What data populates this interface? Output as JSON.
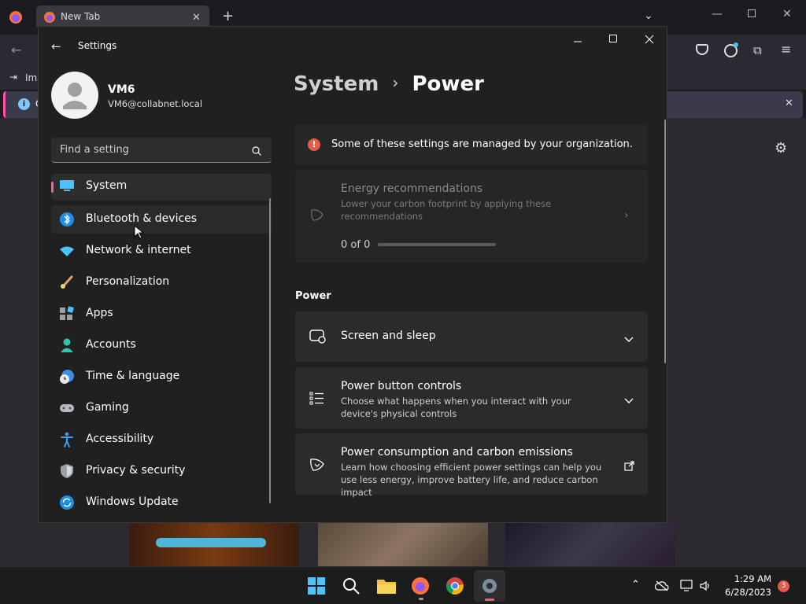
{
  "browser": {
    "tab_title": "New Tab",
    "bookmark_import_label": "Imp",
    "info_prefix": "C"
  },
  "settings": {
    "window_title": "Settings",
    "user": {
      "name": "VM6",
      "email": "VM6@collabnet.local"
    },
    "search": {
      "placeholder": "Find a setting"
    },
    "breadcrumb": {
      "parent": "System",
      "separator": "›",
      "current": "Power"
    },
    "nav_items": [
      {
        "label": "System",
        "icon": "system-icon",
        "selected": true
      },
      {
        "label": "Bluetooth & devices",
        "icon": "bluetooth-icon"
      },
      {
        "label": "Network & internet",
        "icon": "wifi-icon"
      },
      {
        "label": "Personalization",
        "icon": "brush-icon"
      },
      {
        "label": "Apps",
        "icon": "apps-icon"
      },
      {
        "label": "Accounts",
        "icon": "person-icon"
      },
      {
        "label": "Time & language",
        "icon": "clock-globe-icon"
      },
      {
        "label": "Gaming",
        "icon": "gamepad-icon"
      },
      {
        "label": "Accessibility",
        "icon": "accessibility-icon"
      },
      {
        "label": "Privacy & security",
        "icon": "shield-icon"
      },
      {
        "label": "Windows Update",
        "icon": "update-icon"
      }
    ],
    "managed_notice": "Some of these settings are managed by your organization.",
    "energy": {
      "title": "Energy recommendations",
      "subtitle": "Lower your carbon footprint by applying these recommendations",
      "progress_text": "0 of 0",
      "progress_fraction": 0
    },
    "section_title": "Power",
    "items": [
      {
        "title": "Screen and sleep",
        "subtitle": "",
        "icon": "screen-sleep-icon",
        "action": "expand"
      },
      {
        "title": "Power button controls",
        "subtitle": "Choose what happens when you interact with your device's physical controls",
        "icon": "list-icon",
        "action": "expand"
      },
      {
        "title": "Power consumption and carbon emissions",
        "subtitle": "Learn how choosing efficient power settings can help you use less energy, improve battery life, and reduce carbon impact",
        "icon": "leaf-heart-icon",
        "action": "external"
      }
    ]
  },
  "taskbar": {
    "time": "1:29 AM",
    "date": "6/28/2023",
    "notification_count": "3"
  },
  "colors": {
    "accent": "#4cc2ff",
    "selected_indicator": "#ff5f9e",
    "window_bg": "#202020",
    "card_bg": "#2b2b2b",
    "notice_icon": "#e05c4b"
  }
}
